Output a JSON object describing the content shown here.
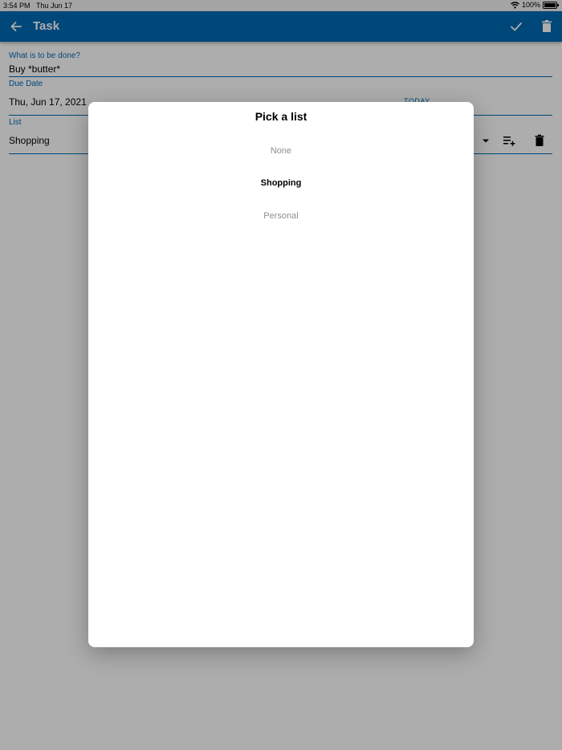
{
  "status_bar": {
    "time": "3:54 PM",
    "date": "Thu Jun 17",
    "battery": "100%"
  },
  "app_bar": {
    "title": "Task",
    "icons": [
      "back-arrow-icon",
      "check-icon",
      "trash-icon"
    ],
    "color": "#0069b4"
  },
  "form": {
    "task_label": "What is to be done?",
    "task_value": "Buy *butter*",
    "due_label": "Due Date",
    "due_value": "Thu, Jun 17, 2021",
    "today_button": "TODAY",
    "list_label": "List",
    "list_value": "Shopping"
  },
  "dialog": {
    "title": "Pick a list",
    "options": [
      "None",
      "Shopping",
      "Personal"
    ],
    "selected": "Shopping"
  }
}
